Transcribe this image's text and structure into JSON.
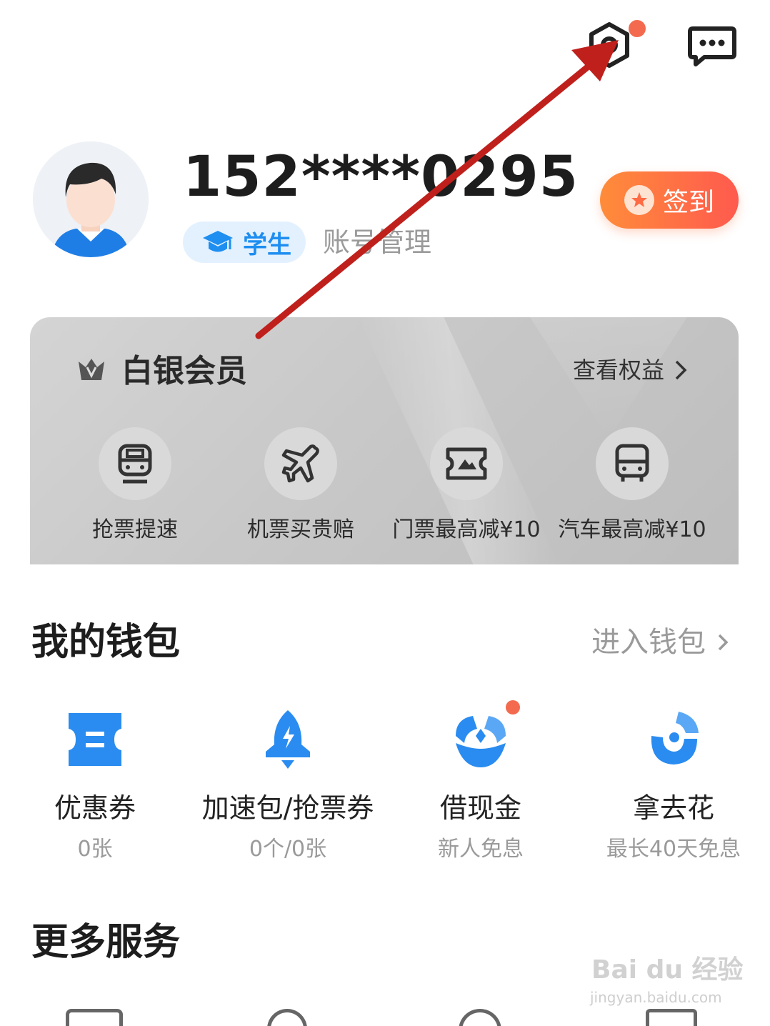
{
  "topbar": {
    "settings_icon": "settings-hexagon-icon",
    "message_icon": "message-dots-icon",
    "notification_color": "#f46a4e"
  },
  "profile": {
    "phone": "152****0295",
    "student_label": "学生",
    "account_manage": "账号管理",
    "signin_label": "签到"
  },
  "member": {
    "title": "白银会员",
    "benefit_link": "查看权益",
    "perks": [
      {
        "label": "抢票提速",
        "icon": "train-icon"
      },
      {
        "label": "机票买贵赔",
        "icon": "plane-icon"
      },
      {
        "label": "门票最高减¥10",
        "icon": "ticket-icon"
      },
      {
        "label": "汽车最高减¥10",
        "icon": "bus-icon"
      }
    ]
  },
  "wallet": {
    "title": "我的钱包",
    "link": "进入钱包",
    "items": [
      {
        "name": "优惠券",
        "sub": "0张"
      },
      {
        "name": "加速包/抢票券",
        "sub": "0个/0张"
      },
      {
        "name": "借现金",
        "sub": "新人免息"
      },
      {
        "name": "拿去花",
        "sub": "最长40天免息"
      }
    ]
  },
  "more": {
    "title": "更多服务"
  },
  "watermark": {
    "main": "Bai du 经验",
    "sub": "jingyan.baidu.com"
  },
  "colors": {
    "accent_blue": "#1e8ef0",
    "signin_gradient_start": "#ff8c3a",
    "signin_gradient_end": "#ff5a4e",
    "annotation_arrow": "#c0201c"
  }
}
